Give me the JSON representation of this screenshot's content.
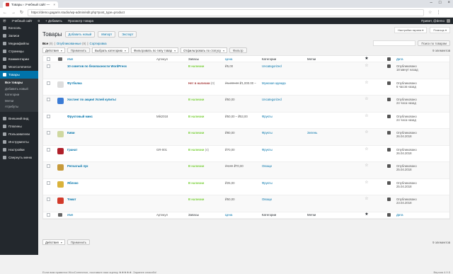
{
  "browser": {
    "tab_title": "Товары ‹ Учебный сайт —",
    "url": "https://demo.gagarin.studio/wp-admin/edit.php?post_type=product"
  },
  "adminbar": {
    "site": "Учебный сайт",
    "comments": "0",
    "add": "+ Добавить",
    "view": "Просмотр товара",
    "greeting": "Привет, @demo"
  },
  "sidebar": {
    "items": [
      {
        "label": "Консоль",
        "icon": "dashboard-icon"
      },
      {
        "label": "Записи",
        "icon": "pin-icon"
      },
      {
        "label": "Медиафайлы",
        "icon": "media-icon"
      },
      {
        "label": "Страницы",
        "icon": "pages-icon"
      },
      {
        "label": "Комментарии",
        "icon": "comments-icon"
      },
      {
        "label": "WooCommerce",
        "icon": "woo-icon"
      },
      {
        "label": "Товары",
        "icon": "products-icon",
        "active": true
      }
    ],
    "sub": [
      "Все товары",
      "Добавить новый",
      "Категории",
      "Метки",
      "Атрибуты"
    ],
    "items2": [
      {
        "label": "Внешний вид",
        "icon": "appearance-icon"
      },
      {
        "label": "Плагины",
        "icon": "plugins-icon"
      },
      {
        "label": "Пользователи",
        "icon": "users-icon"
      },
      {
        "label": "Инструменты",
        "icon": "tools-icon"
      },
      {
        "label": "Настройки",
        "icon": "settings-icon"
      },
      {
        "label": "Свернуть меню",
        "icon": "collapse-icon"
      }
    ]
  },
  "screen_options": [
    "Настройки экрана ▾",
    "Помощь ▾"
  ],
  "header": {
    "title": "Товары",
    "add_new": "Добавить новый",
    "import": "Импорт",
    "export": "Экспорт"
  },
  "filters": {
    "all": "Все",
    "all_count": "(9)",
    "published": "Опубликованные",
    "published_count": "(9)",
    "sorting": "Сортировка",
    "search_button": "Поиск по товарам",
    "bulk_action": "Действия",
    "apply": "Применить",
    "category": "Выбрать категорию",
    "type": "Фильтровать по типу товар",
    "stock": "Отфильтровать по статусу",
    "filter": "Фильтр",
    "count": "9 элементов"
  },
  "columns": {
    "name": "Имя",
    "sku": "Артикул",
    "stock": "Запасы",
    "price": "Цена",
    "categories": "Категории",
    "tags": "Метки",
    "date": "Дата"
  },
  "rows": [
    {
      "name": "10 советов по безопасности WordPress",
      "sku": "",
      "stock": "В наличии",
      "stock_state": "in",
      "stock_count": "",
      "price": "₽5,00",
      "price_old": "",
      "cat": "Uncategorized",
      "tag": "",
      "featured": false,
      "date1": "Опубликовано",
      "date2": "18 минут назад",
      "thumb": ""
    },
    {
      "name": "Футболка",
      "sku": "",
      "stock": "Нет в наличии",
      "stock_state": "out",
      "stock_count": "(0)",
      "price": "₽1,000.00 –",
      "price_old": "₽1,200.00",
      "cat": "Мужская одежда",
      "tag": "",
      "featured": false,
      "date1": "Опубликовано",
      "date2": "6 часов назад",
      "thumb": "#ddd"
    },
    {
      "name": "Хостинг по акции! Успей купить!",
      "sku": "",
      "stock": "В наличии",
      "stock_state": "in",
      "stock_count": "",
      "price": "₽50,00",
      "price_old": "",
      "cat": "Uncategorized",
      "tag": "",
      "featured": false,
      "date1": "Опубликовано",
      "date2": "24 часа назад",
      "thumb": "#3a7bd5"
    },
    {
      "name": "Фруктовый микс",
      "sku": "Mik2018",
      "stock": "В наличии",
      "stock_state": "in",
      "stock_count": "",
      "price": "₽50,00 – ₽53,00",
      "price_old": "",
      "cat": "Фрукты",
      "tag": "",
      "featured": false,
      "date1": "Опубликовано",
      "date2": "24 часа назад",
      "thumb": ""
    },
    {
      "name": "Киви",
      "sku": "",
      "stock": "В наличии",
      "stock_state": "in",
      "stock_count": "",
      "price": "₽80,00",
      "price_old": "",
      "cat": "Фрукты",
      "tag": "Зелень",
      "featured": false,
      "date1": "Опубликовано",
      "date2": "26.04.2018",
      "thumb": "#cfd8a0"
    },
    {
      "name": "Гранат",
      "sku": "GR-001",
      "stock": "В наличии",
      "stock_state": "in",
      "stock_count": "(4)",
      "price": "₽70,00",
      "price_old": "",
      "cat": "Фрукты",
      "tag": "",
      "featured": false,
      "date1": "Опубликовано",
      "date2": "26.04.2018",
      "thumb": "#b0202a"
    },
    {
      "name": "Репчатый лук",
      "sku": "",
      "stock": "В наличии",
      "stock_state": "in",
      "stock_count": "",
      "price": "₽70,00",
      "price_old": "₽4,00",
      "cat": "Овощи",
      "tag": "",
      "featured": false,
      "date1": "Опубликовано",
      "date2": "25.04.2018",
      "thumb": "#c79a3a"
    },
    {
      "name": "Яблоко",
      "sku": "",
      "stock": "В наличии",
      "stock_state": "in",
      "stock_count": "",
      "price": "₽25,00",
      "price_old": "",
      "cat": "Фрукты",
      "tag": "",
      "featured": false,
      "date1": "Опубликовано",
      "date2": "25.04.2018",
      "thumb": "#d9b23a"
    },
    {
      "name": "Томат",
      "sku": "",
      "stock": "В наличии",
      "stock_state": "in",
      "stock_count": "",
      "price": "₽50,00",
      "price_old": "",
      "cat": "Овощи",
      "tag": "",
      "featured": false,
      "date1": "Опубликовано",
      "date2": "23.04.2018",
      "thumb": "#d23a2a"
    }
  ],
  "footer": {
    "left": "Если вам нравится WooCommerce, поставьте нам оценку ★★★★★. Заранее спасибо!",
    "version": "Версия 4.9.5"
  }
}
